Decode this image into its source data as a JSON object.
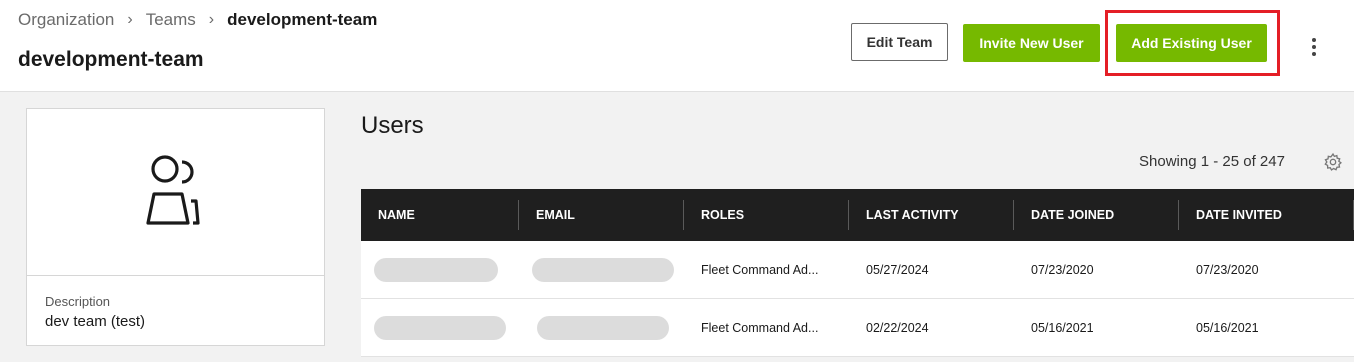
{
  "header": {
    "breadcrumb": {
      "organization": "Organization",
      "teams": "Teams",
      "current": "development-team",
      "separator": "›"
    },
    "page_title": "development-team",
    "buttons": {
      "edit_team": "Edit Team",
      "invite_new_user": "Invite New User",
      "add_existing_user": "Add Existing User"
    }
  },
  "team_card": {
    "description_label": "Description",
    "description_value": "dev team (test)"
  },
  "users": {
    "title": "Users",
    "showing": "Showing 1 - 25 of 247",
    "columns": [
      "NAME",
      "EMAIL",
      "ROLES",
      "LAST ACTIVITY",
      "DATE JOINED",
      "DATE INVITED"
    ],
    "rows": [
      {
        "roles": "Fleet Command Ad...",
        "last_activity": "05/27/2024",
        "date_joined": "07/23/2020",
        "date_invited": "07/23/2020"
      },
      {
        "roles": "Fleet Command Ad...",
        "last_activity": "02/22/2024",
        "date_joined": "05/16/2021",
        "date_invited": "05/16/2021"
      }
    ]
  },
  "colors": {
    "accent_green": "#76b900",
    "highlight_red": "#e41e26",
    "table_header": "#1f1f1f"
  }
}
